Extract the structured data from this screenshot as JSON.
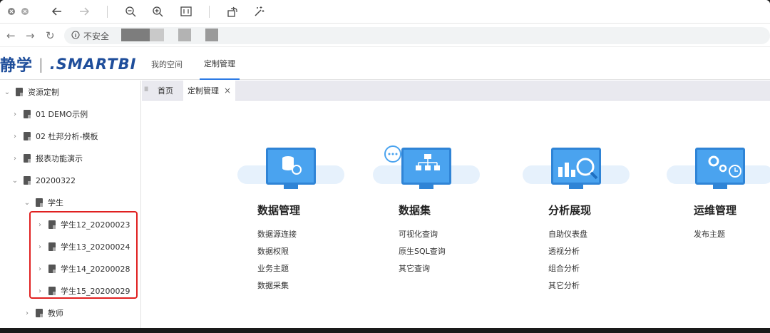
{
  "toolbar": {
    "icons": [
      "close-icon",
      "close-icon",
      "back-arrow-icon",
      "forward-arrow-icon",
      "zoom-out-icon",
      "zoom-in-icon",
      "fit-page-icon",
      "rotate-icon",
      "magic-wand-icon"
    ]
  },
  "addressbar": {
    "security_label": "不安全"
  },
  "header": {
    "logo_cn": "静学",
    "logo_sep": "|",
    "logo_brand": ".SMARTBI",
    "nav": [
      "我的空间",
      "定制管理"
    ]
  },
  "sidebar": {
    "items": [
      {
        "label": "资源定制",
        "expanded": true
      },
      {
        "label": "01 DEMO示例",
        "expanded": false
      },
      {
        "label": "02 杜邦分析-模板",
        "expanded": false
      },
      {
        "label": "报表功能演示",
        "expanded": false
      },
      {
        "label": "20200322",
        "expanded": true
      },
      {
        "label": "学生",
        "expanded": true
      },
      {
        "label": "学生12_20200023",
        "expanded": false
      },
      {
        "label": "学生13_20200024",
        "expanded": false
      },
      {
        "label": "学生14_20200028",
        "expanded": false
      },
      {
        "label": "学生15_20200029",
        "expanded": false
      },
      {
        "label": "教师",
        "expanded": false
      }
    ]
  },
  "tabs": {
    "grip": "Ⅲ",
    "items": [
      "首页",
      "定制管理"
    ],
    "close": "×"
  },
  "cards": [
    {
      "title": "数据管理",
      "links": [
        "数据源连接",
        "数据权限",
        "业务主题",
        "数据采集"
      ],
      "icon": "database-gear-icon"
    },
    {
      "title": "数据集",
      "links": [
        "可视化查询",
        "原生SQL查询",
        "其它查询"
      ],
      "icon": "hierarchy-chat-icon"
    },
    {
      "title": "分析展现",
      "links": [
        "自助仪表盘",
        "透视分析",
        "组合分析",
        "其它分析"
      ],
      "icon": "bar-chart-magnifier-icon"
    },
    {
      "title": "运维管理",
      "links": [
        "发布主题"
      ],
      "icon": "gears-clock-icon"
    }
  ],
  "colors": {
    "accent": "#2d7be5",
    "highlight_border": "#e02020",
    "logo": "#1f4e9b",
    "icon_blue": "#4aa3ef"
  }
}
